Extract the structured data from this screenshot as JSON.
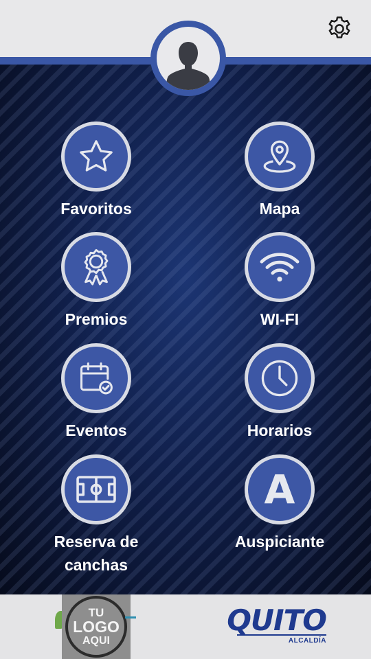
{
  "header": {
    "settings_icon": "gear-icon",
    "avatar_icon": "user-silhouette-icon"
  },
  "menu": [
    {
      "id": "favoritos",
      "label": "Favoritos",
      "icon": "star-icon"
    },
    {
      "id": "mapa",
      "label": "Mapa",
      "icon": "map-pin-icon"
    },
    {
      "id": "premios",
      "label": "Premios",
      "icon": "award-ribbon-icon"
    },
    {
      "id": "wifi",
      "label": "WI-FI",
      "icon": "wifi-icon"
    },
    {
      "id": "eventos",
      "label": "Eventos",
      "icon": "calendar-check-icon"
    },
    {
      "id": "horarios",
      "label": "Horarios",
      "icon": "clock-icon"
    },
    {
      "id": "reserva",
      "label_line1": "Reserva de",
      "label_line2": "canchas",
      "icon": "soccer-field-icon"
    },
    {
      "id": "auspiciante",
      "label": "Auspiciante",
      "icon_letter": "A",
      "icon": "letter-a-icon"
    }
  ],
  "footer": {
    "placeholder_logo": {
      "line1": "TU",
      "line2": "LOGO",
      "line3": "AQUI"
    },
    "brand_logo": {
      "word": "QUITO",
      "sub": "ALCALDÍA"
    }
  },
  "colors": {
    "accent": "#3a57a6",
    "circle_border": "#d8dbe4",
    "brand_blue": "#1f3a8f"
  }
}
